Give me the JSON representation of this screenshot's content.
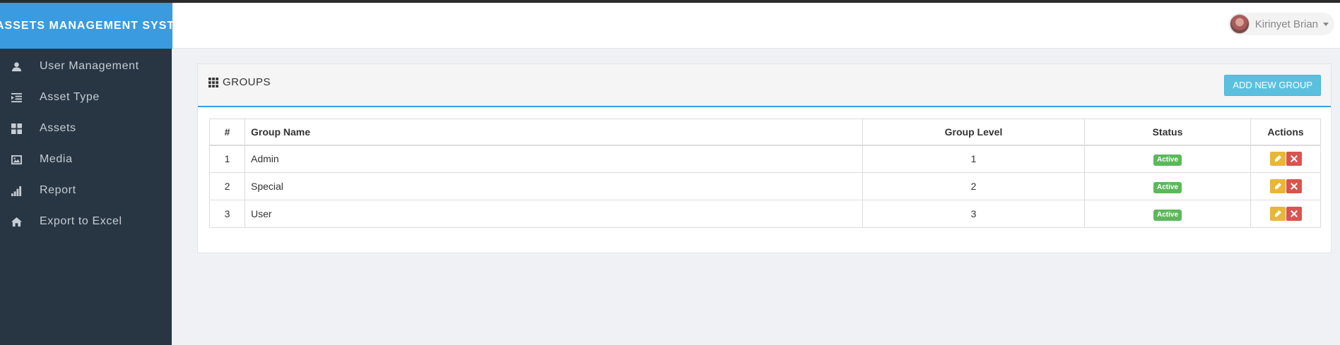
{
  "brand": "ASSETS MANAGEMENT SYSTEM",
  "user": {
    "name": "Kirinyet Brian"
  },
  "sidebar": {
    "items": [
      {
        "label": "User Management",
        "icon": "user-icon"
      },
      {
        "label": "Asset Type",
        "icon": "indent-icon"
      },
      {
        "label": "Assets",
        "icon": "th-large-icon"
      },
      {
        "label": "Media",
        "icon": "picture-icon"
      },
      {
        "label": "Report",
        "icon": "signal-icon"
      },
      {
        "label": "Export to Excel",
        "icon": "home-icon"
      }
    ]
  },
  "panel": {
    "title": "GROUPS",
    "icon": "th-icon",
    "add_button": "ADD NEW GROUP"
  },
  "table": {
    "headers": {
      "num": "#",
      "name": "Group Name",
      "level": "Group Level",
      "status": "Status",
      "actions": "Actions"
    },
    "rows": [
      {
        "num": "1",
        "name": "Admin",
        "level": "1",
        "status": "Active"
      },
      {
        "num": "2",
        "name": "Special",
        "level": "2",
        "status": "Active"
      },
      {
        "num": "3",
        "name": "User",
        "level": "3",
        "status": "Active"
      }
    ]
  },
  "colors": {
    "brand": "#3a9be0",
    "sidebar": "#283643",
    "add_button": "#5bc0de",
    "active_badge": "#5cb85c",
    "edit_button": "#e8b739",
    "delete_button": "#d9534f"
  }
}
